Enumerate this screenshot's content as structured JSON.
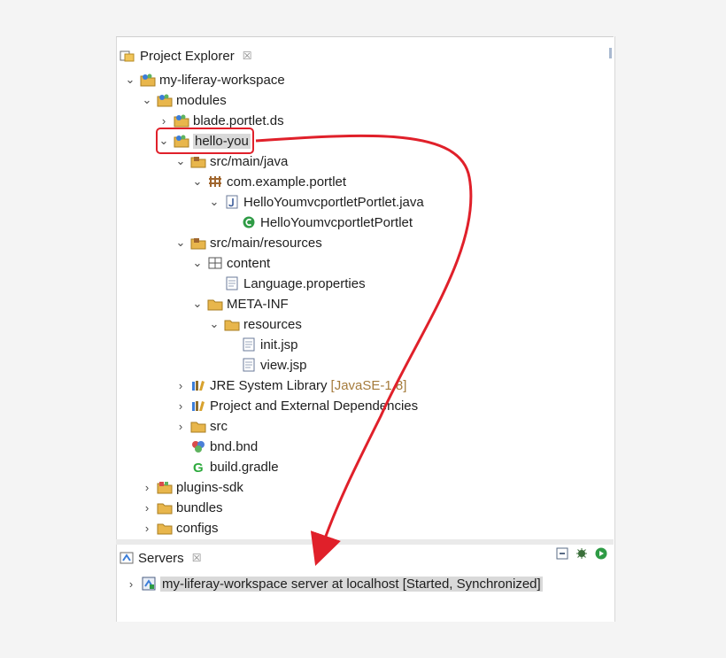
{
  "project_explorer": {
    "tab_label": "Project Explorer",
    "close_glyph": "☒"
  },
  "tree": [
    {
      "label": "my-liferay-workspace",
      "twisty": "⌄",
      "icon": "workspace-icon"
    },
    {
      "label": "modules",
      "twisty": "⌄",
      "icon": "folder-project-icon"
    },
    {
      "label": "blade.portlet.ds",
      "twisty": "›",
      "icon": "project-icon"
    },
    {
      "label": "hello-you",
      "twisty": "⌄",
      "icon": "project-icon",
      "selected": true
    },
    {
      "label": "src/main/java",
      "twisty": "⌄",
      "icon": "source-folder-icon"
    },
    {
      "label": "com.example.portlet",
      "twisty": "⌄",
      "icon": "package-icon"
    },
    {
      "label": "HelloYoumvcportletPortlet.java",
      "twisty": "⌄",
      "icon": "java-file-icon"
    },
    {
      "label": "HelloYoumvcportletPortlet",
      "twisty": "",
      "icon": "class-icon"
    },
    {
      "label": "src/main/resources",
      "twisty": "⌄",
      "icon": "source-folder-icon"
    },
    {
      "label": "content",
      "twisty": "⌄",
      "icon": "package-icon-outline"
    },
    {
      "label": "Language.properties",
      "twisty": "",
      "icon": "file-icon"
    },
    {
      "label": "META-INF",
      "twisty": "⌄",
      "icon": "folder-icon"
    },
    {
      "label": "resources",
      "twisty": "⌄",
      "icon": "folder-icon"
    },
    {
      "label": "init.jsp",
      "twisty": "",
      "icon": "file-icon"
    },
    {
      "label": "view.jsp",
      "twisty": "",
      "icon": "file-icon"
    },
    {
      "label": "JRE System Library",
      "decoration": "[JavaSE-1.8]",
      "twisty": "›",
      "icon": "library-icon"
    },
    {
      "label": "Project and External Dependencies",
      "twisty": "›",
      "icon": "library-icon"
    },
    {
      "label": "src",
      "twisty": "›",
      "icon": "folder-icon"
    },
    {
      "label": "bnd.bnd",
      "twisty": "",
      "icon": "bnd-icon"
    },
    {
      "label": "build.gradle",
      "twisty": "",
      "icon": "gradle-icon"
    },
    {
      "label": "plugins-sdk",
      "twisty": "›",
      "icon": "plugins-icon"
    },
    {
      "label": "bundles",
      "twisty": "›",
      "icon": "folder-icon"
    },
    {
      "label": "configs",
      "twisty": "›",
      "icon": "folder-icon"
    }
  ],
  "servers": {
    "tab_label": "Servers",
    "close_glyph": "☒",
    "entry_twisty": "›",
    "entry_label": "my-liferay-workspace server at localhost  [Started, Synchronized]"
  },
  "colors": {
    "highlight": "#e0202a",
    "folder": "#e8b64c",
    "project": "#3b7dd8",
    "package": "#a0662e",
    "class": "#2e9b45",
    "gradle": "#2eaa3e"
  }
}
